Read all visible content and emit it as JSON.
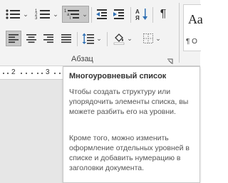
{
  "ribbon": {
    "group_label": "Абзац",
    "styles_preview": {
      "sample": "Аа",
      "name": "¶ О"
    },
    "buttons": {
      "bullets": "bullets-list-icon",
      "numbering": "numbered-list-icon",
      "multilevel": "multilevel-list-icon",
      "decrease_indent": "decrease-indent-icon",
      "increase_indent": "increase-indent-icon",
      "sort": "sort-icon",
      "show_marks": "pilcrow-icon",
      "align_left": "align-left-icon",
      "center": "align-center-icon",
      "align_right": "align-right-icon",
      "justify": "justify-icon",
      "line_spacing": "line-spacing-icon",
      "shading": "shading-icon",
      "borders": "borders-icon"
    }
  },
  "ruler": {
    "marks": [
      "2",
      "3"
    ]
  },
  "tooltip": {
    "title": "Многоуровневый список",
    "para1": "Чтобы создать структуру или упорядочить элементы списка, вы можете разбить его на уровни.",
    "para2": "Кроме того, можно изменить оформление отдельных уровней в списке и добавить нумерацию в заголовки документа."
  }
}
